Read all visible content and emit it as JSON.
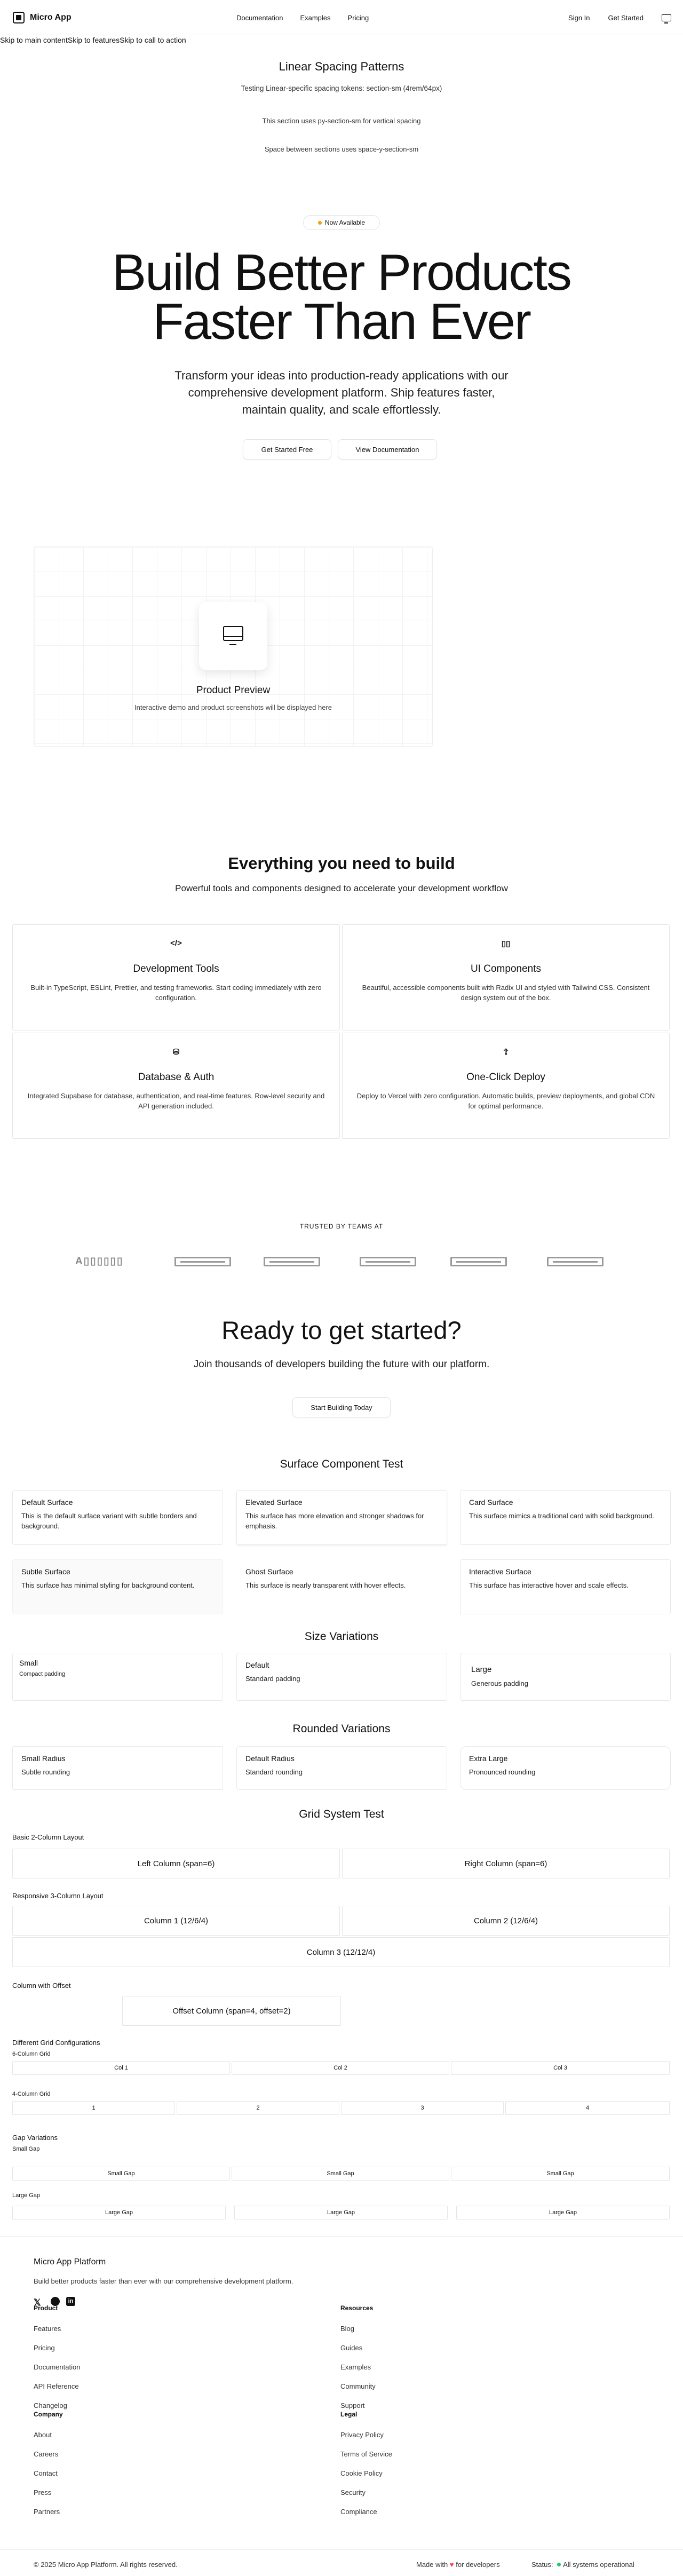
{
  "header": {
    "app_name": "Micro App",
    "nav": [
      "Documentation",
      "Examples",
      "Pricing"
    ],
    "sign_in": "Sign In",
    "get_started": "Get Started"
  },
  "skip_links": [
    "Skip to main content",
    "Skip to features",
    "Skip to call to action"
  ],
  "spacing": {
    "title": "Linear Spacing Patterns",
    "subtitle": "Testing Linear-specific spacing tokens: section-sm (4rem/64px)",
    "py_note": "This section uses py-section-sm for vertical spacing",
    "space_note": "Space between sections uses space-y-section-sm"
  },
  "hero": {
    "badge": "Now Available",
    "title_line1": "Build Better Products",
    "title_line2": "Faster Than Ever",
    "subtitle": "Transform your ideas into production-ready applications with our comprehensive development platform. Ship features faster, maintain quality, and scale effortlessly.",
    "primary_btn": "Get Started Free",
    "secondary_btn": "View Documentation"
  },
  "preview": {
    "icon": "monitor-icon",
    "title": "Product Preview",
    "subtitle": "Interactive demo and product screenshots will be displayed here"
  },
  "features": {
    "title": "Everything you need to build",
    "subtitle": "Powerful tools and components designed to accelerate your development workflow",
    "items": [
      {
        "icon": "</>",
        "title": "Development Tools",
        "desc": "Built-in TypeScript, ESLint, Prettier, and testing frameworks. Start coding immediately with zero configuration."
      },
      {
        "icon": "▯▯",
        "title": "UI Components",
        "desc": "Beautiful, accessible components built with Radix UI and styled with Tailwind CSS. Consistent design system out of the box."
      },
      {
        "icon": "⛁",
        "title": "Database & Auth",
        "desc": "Integrated Supabase for database, authentication, and real-time features. Row-level security and API generation included."
      },
      {
        "icon": "⇪",
        "title": "One-Click Deploy",
        "desc": "Deploy to Vercel with zero configuration. Automatic builds, preview deployments, and global CDN for optimal performance."
      }
    ]
  },
  "trusted": {
    "title": "TRUSTED BY TEAMS AT",
    "first_logo": "A▯▯▯▯▯▯"
  },
  "cta": {
    "title": "Ready to get started?",
    "subtitle": "Join thousands of developers building the future with our platform.",
    "button": "Start Building Today"
  },
  "surface": {
    "title": "Surface Component Test",
    "cards": [
      {
        "title": "Default Surface",
        "desc": "This is the default surface variant with subtle borders and background."
      },
      {
        "title": "Elevated Surface",
        "desc": "This surface has more elevation and stronger shadows for emphasis."
      },
      {
        "title": "Card Surface",
        "desc": "This surface mimics a traditional card with solid background."
      },
      {
        "title": "Subtle Surface",
        "desc": "This surface has minimal styling for background content."
      },
      {
        "title": "Ghost Surface",
        "desc": "This surface is nearly transparent with hover effects."
      },
      {
        "title": "Interactive Surface",
        "desc": "This surface has interactive hover and scale effects."
      }
    ]
  },
  "sizes": {
    "title": "Size Variations",
    "items": [
      {
        "title": "Small",
        "desc": "Compact padding"
      },
      {
        "title": "Default",
        "desc": "Standard padding"
      },
      {
        "title": "Large",
        "desc": "Generous padding"
      }
    ]
  },
  "rounded": {
    "title": "Rounded Variations",
    "items": [
      {
        "title": "Small Radius",
        "desc": "Subtle rounding"
      },
      {
        "title": "Default Radius",
        "desc": "Standard rounding"
      },
      {
        "title": "Extra Large",
        "desc": "Pronounced rounding"
      }
    ]
  },
  "grid": {
    "title": "Grid System Test",
    "basic_label": "Basic 2-Column Layout",
    "basic": [
      "Left Column (span=6)",
      "Right Column (span=6)"
    ],
    "resp_label": "Responsive 3-Column Layout",
    "resp": [
      "Column 1 (12/6/4)",
      "Column 2 (12/6/4)",
      "Column 3 (12/12/4)"
    ],
    "offset_label": "Column with Offset",
    "offset": "Offset Column (span=4, offset=2)",
    "configs_label": "Different Grid Configurations",
    "six_label": "6-Column Grid",
    "six": [
      "Col 1",
      "Col 2",
      "Col 3"
    ],
    "four_label": "4-Column Grid",
    "four": [
      "1",
      "2",
      "3",
      "4"
    ],
    "gap_label": "Gap Variations",
    "small_gap_label": "Small Gap",
    "small_gap": [
      "Small Gap",
      "Small Gap",
      "Small Gap"
    ],
    "large_gap_label": "Large Gap",
    "large_gap": [
      "Large Gap",
      "Large Gap",
      "Large Gap"
    ]
  },
  "footer": {
    "brand": "Micro App Platform",
    "tagline": "Build better products faster than ever with our comprehensive development platform.",
    "social": [
      "x-icon",
      "github-icon",
      "linkedin-icon"
    ],
    "product": {
      "title": "Product",
      "links": [
        "Features",
        "Pricing",
        "Documentation",
        "API Reference",
        "Changelog"
      ]
    },
    "resources": {
      "title": "Resources",
      "links": [
        "Blog",
        "Guides",
        "Examples",
        "Community",
        "Support"
      ]
    },
    "company": {
      "title": "Company",
      "links": [
        "About",
        "Careers",
        "Contact",
        "Press",
        "Partners"
      ]
    },
    "legal": {
      "title": "Legal",
      "links": [
        "Privacy Policy",
        "Terms of Service",
        "Cookie Policy",
        "Security",
        "Compliance"
      ]
    },
    "copyright": "© 2025 Micro App Platform. All rights reserved.",
    "made_with_prefix": "Made with",
    "made_with_suffix": "for developers",
    "status_label": "Status:",
    "status_value": "All systems operational"
  }
}
